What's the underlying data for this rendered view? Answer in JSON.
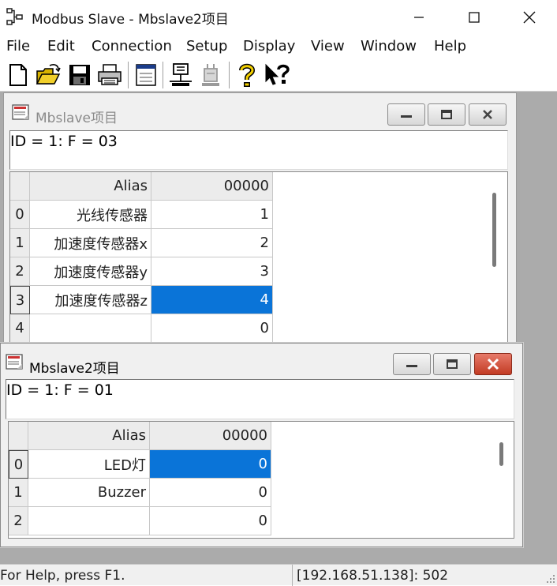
{
  "app": {
    "title": "Modbus Slave - Mbslave2项目"
  },
  "menu": [
    "File",
    "Edit",
    "Connection",
    "Setup",
    "Display",
    "View",
    "Window",
    "Help"
  ],
  "toolbar": {
    "buttons": [
      "new-icon",
      "open-icon",
      "save-icon",
      "print-icon",
      "window-icon",
      "connect-icon",
      "disconnect-icon",
      "help-icon",
      "context-help-icon"
    ]
  },
  "windows": [
    {
      "title": "Mbslave项目",
      "id_line": "ID = 1: F = 03",
      "header": {
        "alias": "Alias",
        "col": "00000"
      },
      "rows": [
        {
          "num": "0",
          "alias": "光线传感器",
          "value": "1"
        },
        {
          "num": "1",
          "alias": "加速度传感器x",
          "value": "2"
        },
        {
          "num": "2",
          "alias": "加速度传感器y",
          "value": "3"
        },
        {
          "num": "3",
          "alias": "加速度传感器z",
          "value": "4"
        },
        {
          "num": "4",
          "alias": "",
          "value": "0"
        }
      ]
    },
    {
      "title": "Mbslave2项目",
      "id_line": "ID = 1: F = 01",
      "header": {
        "alias": "Alias",
        "col": "00000"
      },
      "rows": [
        {
          "num": "0",
          "alias": "LED灯",
          "value": "0"
        },
        {
          "num": "1",
          "alias": "Buzzer",
          "value": "0"
        },
        {
          "num": "2",
          "alias": "",
          "value": "0"
        }
      ]
    }
  ],
  "status": {
    "left": "For Help, press F1.",
    "right": "[192.168.51.138]: 502"
  }
}
